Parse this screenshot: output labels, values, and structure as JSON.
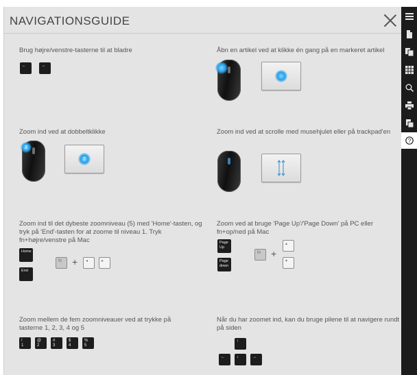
{
  "header": {
    "title": "NAVIGATIONSGUIDE"
  },
  "sidebar": {
    "icons": [
      "menu-icon",
      "page-icon",
      "pages-icon",
      "grid-icon",
      "search-icon",
      "print-icon",
      "download-icon",
      "help-icon"
    ]
  },
  "sections": {
    "browse": {
      "text": "Brug højre/venstre-tasterne til at bladre",
      "keys": [
        "←",
        "→"
      ]
    },
    "open": {
      "text": "Åbn en artikel ved at klikke én gang på en markeret artikel"
    },
    "dblclick": {
      "text": "Zoom ind ved at dobbeltklikke",
      "badge": "2"
    },
    "scroll": {
      "text": "Zoom ind ved at scrolle med musehjulet eller på trackpad'en"
    },
    "home": {
      "text": "Zoom ind til det dybeste zoomniveau (5) med 'Home'-tasten, og tryk på 'End'-tasten for at zoome til niveau 1. Tryk fn+højre/venstre på Mac",
      "keys": [
        "Home",
        "End"
      ],
      "combo": [
        "fn",
        "+",
        "◂",
        "▸"
      ]
    },
    "pageupdown": {
      "text": "Zoom ved at bruge 'Page Up'/'Page Down' på PC eller fn+op/ned på Mac",
      "keys": [
        "Page Up",
        "Page down"
      ],
      "combo": [
        "fn",
        "+",
        "▴",
        "▾"
      ]
    },
    "levels": {
      "text": "Zoom mellem de fem zoomniveauer ved at trykke på tasterne 1, 2, 3, 4 og 5",
      "keys": [
        {
          "top": "!",
          "bottom": "1"
        },
        {
          "top": "@",
          "bottom": "2"
        },
        {
          "top": "#",
          "bottom": "3"
        },
        {
          "top": "$",
          "bottom": "4"
        },
        {
          "top": "%",
          "bottom": "5"
        }
      ]
    },
    "arrows": {
      "text": "Når du har zoomet ind, kan du bruge pilene til at navigere rundt på siden",
      "keys": [
        "↑",
        "←",
        "↓",
        "→"
      ]
    }
  },
  "colors": {
    "panel": "#e4e4e4",
    "sidebar": "#1c1c1c",
    "accent": "#28a0ea"
  }
}
